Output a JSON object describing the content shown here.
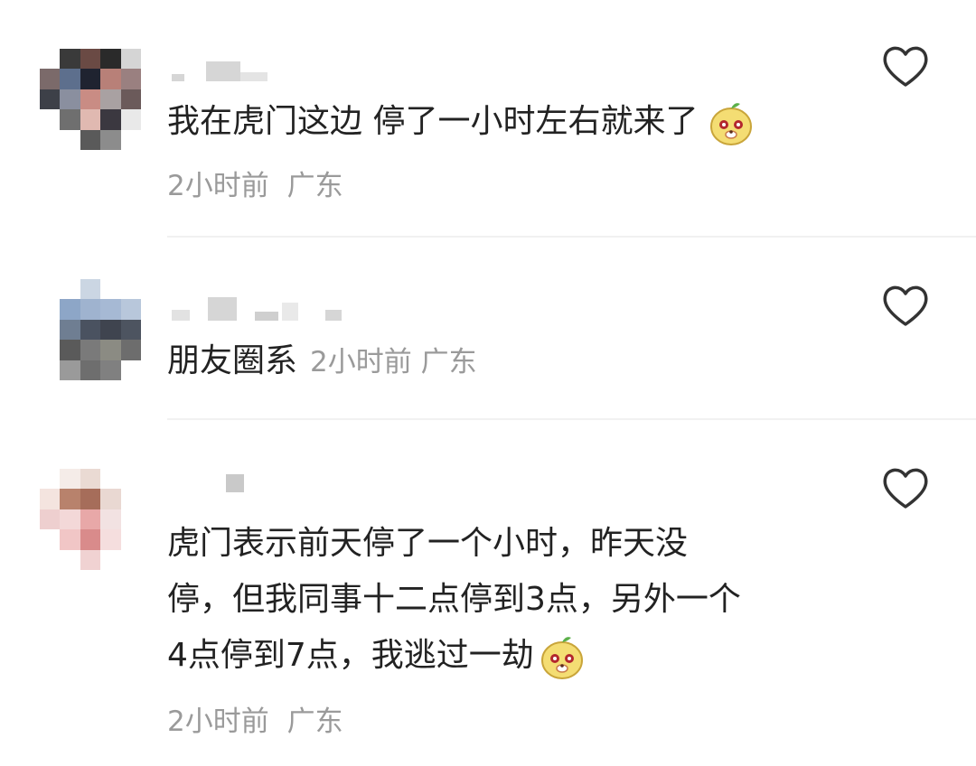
{
  "comments": [
    {
      "text": "我在虎门这边 停了一小时左右就来了",
      "time": "2小时前",
      "location": "广东",
      "emoji": "bear-face-emoji"
    },
    {
      "text": "朋友圈系",
      "time": "2小时前",
      "location": "广东"
    },
    {
      "lines": [
        "虎门表示前天停了一个小时，昨天没",
        "停，但我同事十二点停到3点，另外一个",
        "4点停到7点，我逃过一劫"
      ],
      "time": "2小时前",
      "location": "广东",
      "emoji": "bear-face-emoji"
    }
  ],
  "icons": {
    "like": "heart-outline-icon"
  },
  "colors": {
    "text": "#222222",
    "meta": "#9a9a9a",
    "icon": "#333333",
    "divider": "#f1f1f1"
  }
}
